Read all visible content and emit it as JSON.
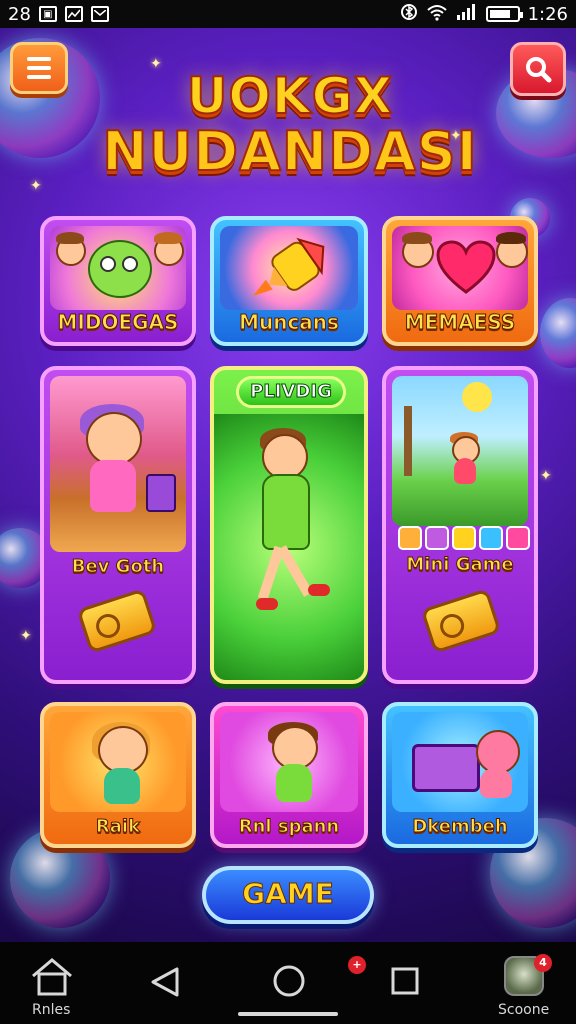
{
  "status_bar": {
    "left_text": "28",
    "time": "1:26",
    "icons": [
      "image-icon",
      "chart-icon",
      "mail-icon",
      "bluetooth-icon",
      "wifi-icon",
      "signal-icon",
      "battery-icon"
    ],
    "battery_level": 0.8
  },
  "header": {
    "logo_line1": "UOKGX",
    "logo_line2": "NUDANDASI",
    "menu_icon": "hamburger-icon",
    "search_icon": "search-icon"
  },
  "cards": {
    "midoegas": "MIDOEGAS",
    "muncans": "Muncans",
    "memaess": "MEMAESS",
    "bev_goth": "Bev Goth",
    "play_badge": "PLIVDIG",
    "mini_game": "Mini Game",
    "raik": "Raik",
    "rnl_spann": "Rnl spann",
    "dkembeh": "Dkembeh"
  },
  "game_button": "GAME",
  "nav": {
    "home_label": "Rnles",
    "home_icon": "home-icon",
    "back_icon": "back-triangle-icon",
    "home_circle_icon": "home-circle-icon",
    "recents_icon": "recents-square-icon",
    "center_badge": "+",
    "profile_label": "Scoone",
    "profile_icon": "avatar-icon",
    "profile_badge": "4"
  },
  "colors": {
    "background": "#5a1fc0",
    "accent_yellow": "#ffd21f",
    "menu_orange": "#f0601a",
    "search_red": "#d8182e",
    "game_blue": "#1a3ad8"
  }
}
